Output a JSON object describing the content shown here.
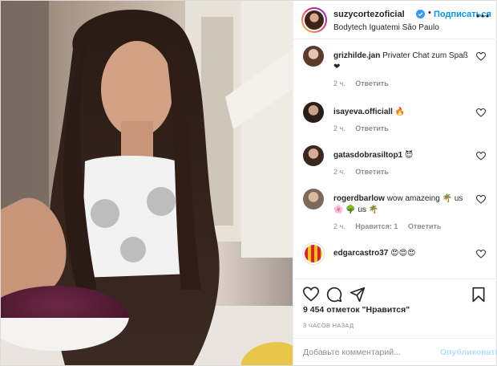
{
  "post": {
    "username": "suzycortezoficial",
    "separator": "•",
    "follow_label": "Подписаться",
    "location": "Bodytech Iguatemi São Paulo",
    "icons": {
      "verified": "verified-badge-icon",
      "more": "more-options-icon",
      "like": "heart-outline-icon",
      "comment": "comment-bubble-icon",
      "share": "paper-plane-icon",
      "save": "bookmark-icon"
    },
    "colors": {
      "accent": "#0095f6",
      "publish_disabled": "#b2dffc",
      "muted": "#8e8e8e",
      "text": "#262626"
    }
  },
  "comments": [
    {
      "user": "grizhilde.jan",
      "text": "Privater Chat zum Spaß❤",
      "time": "2 ч.",
      "reply_label": "Ответить",
      "likes_label": ""
    },
    {
      "user": "isayeva.officiall",
      "text": "🔥",
      "time": "2 ч.",
      "reply_label": "Ответить",
      "likes_label": ""
    },
    {
      "user": "gatasdobrasiltop1",
      "text": "😈",
      "time": "2 ч.",
      "reply_label": "Ответить",
      "likes_label": ""
    },
    {
      "user": "rogerdbarlow",
      "text": "wow amazeing 🌴 us 🌸 🌳 us 🌴",
      "time": "2 ч.",
      "reply_label": "Ответить",
      "likes_label": "Нравится: 1"
    },
    {
      "user": "edgarcastro37",
      "text": "😍😍😍",
      "time": "",
      "reply_label": "",
      "likes_label": ""
    }
  ],
  "likes_text": "9 454 отметок \"Нравится\"",
  "time_ago": "3 ЧАСОВ НАЗАД",
  "add_comment": {
    "placeholder": "Добавьте комментарий...",
    "publish_label": "Опубликовать"
  }
}
